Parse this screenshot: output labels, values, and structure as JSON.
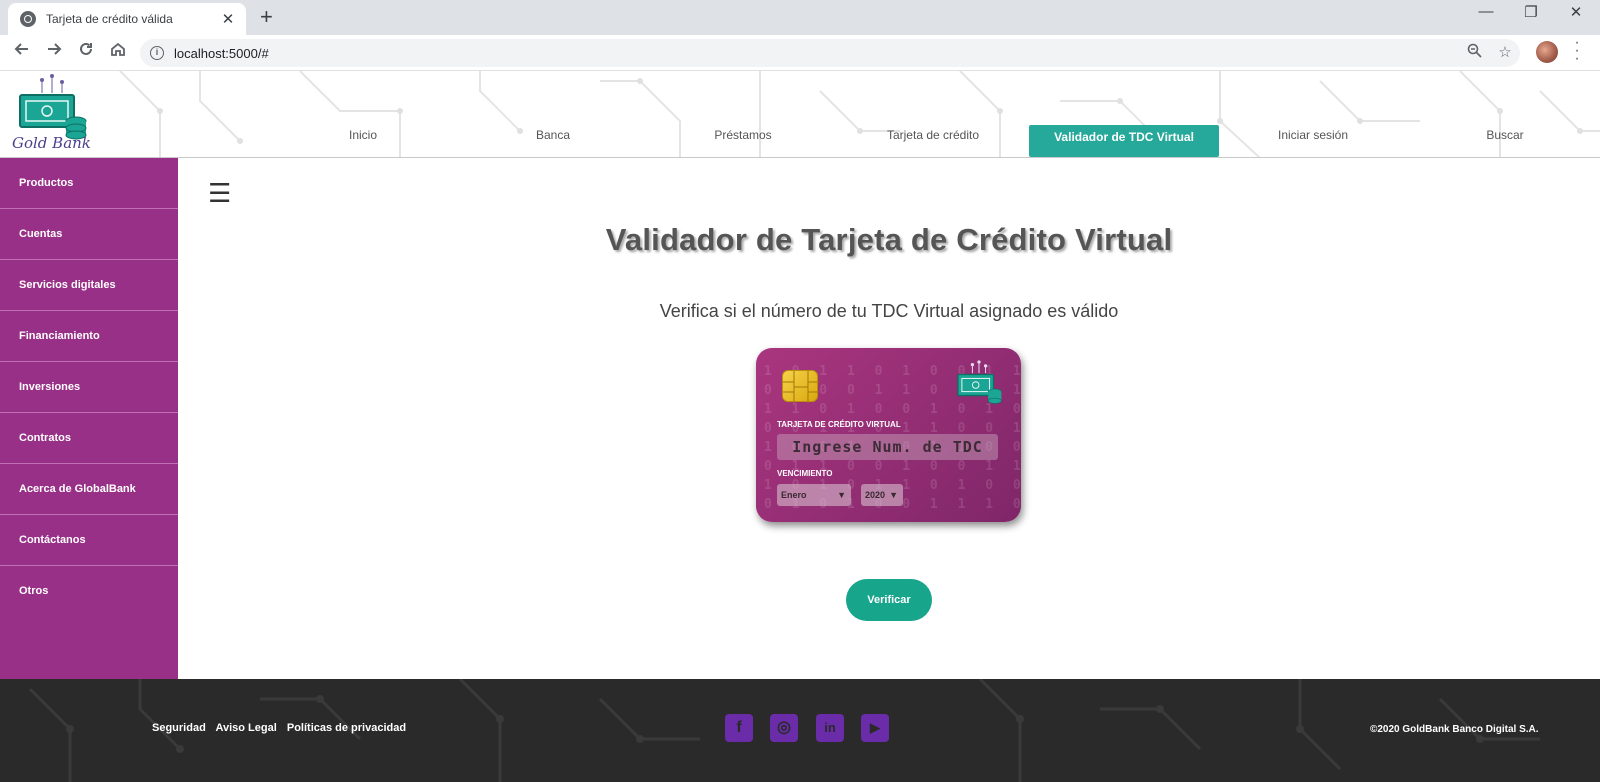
{
  "browser": {
    "tab_title": "Tarjeta de crédito válida",
    "tab_close": "✕",
    "new_tab": "+",
    "window_controls": {
      "minimize": "—",
      "restore": "❐",
      "close": "✕"
    },
    "url": "localhost:5000/#",
    "icons": [
      "back-icon",
      "forward-icon",
      "reload-icon",
      "home-icon",
      "info-icon",
      "zoom-icon",
      "star-icon",
      "profile-avatar",
      "menu-icon"
    ]
  },
  "header": {
    "logo_text": "Gold Bank",
    "nav": [
      {
        "label": "Inicio",
        "active": false
      },
      {
        "label": "Banca",
        "active": false
      },
      {
        "label": "Préstamos",
        "active": false
      },
      {
        "label": "Tarjeta de crédito",
        "active": false
      },
      {
        "label": "Validador de TDC Virtual",
        "active": true
      },
      {
        "label": "Iniciar sesión",
        "active": false
      },
      {
        "label": "Buscar",
        "active": false
      }
    ]
  },
  "sidebar": {
    "items": [
      {
        "label": "Productos"
      },
      {
        "label": "Cuentas"
      },
      {
        "label": "Servicios digitales"
      },
      {
        "label": "Financiamiento"
      },
      {
        "label": "Inversiones"
      },
      {
        "label": "Contratos"
      },
      {
        "label": "Acerca de GlobalBank"
      },
      {
        "label": "Contáctanos"
      },
      {
        "label": "Otros"
      }
    ]
  },
  "main": {
    "menu_toggle": "☰",
    "title": "Validador de Tarjeta de Crédito Virtual",
    "subtitle": "Verifica si el número de tu TDC Virtual asignado es válido",
    "card": {
      "card_label": "TARJETA DE CRÉDITO VIRTUAL",
      "number_placeholder": "Ingrese Num. de TDC",
      "expiry_label": "VENCIMIENTO",
      "month_selected": "Enero",
      "year_selected": "2020",
      "dropdown_arrow": "▼"
    },
    "verify_button": "Verificar"
  },
  "footer": {
    "links": [
      "Seguridad",
      "Aviso Legal",
      "Políticas de privacidad"
    ],
    "social": [
      {
        "name": "facebook-icon",
        "glyph": "f"
      },
      {
        "name": "instagram-icon",
        "glyph": "◎"
      },
      {
        "name": "linkedin-icon",
        "glyph": "in"
      },
      {
        "name": "youtube-icon",
        "glyph": "▶"
      }
    ],
    "copyright": "©2020 GoldBank Banco Digital S.A."
  },
  "colors": {
    "sidebar": "#993087",
    "accent": "#26a89a",
    "button": "#17a58c",
    "footer": "#2a2a2a",
    "social": "#6a2ca8"
  }
}
